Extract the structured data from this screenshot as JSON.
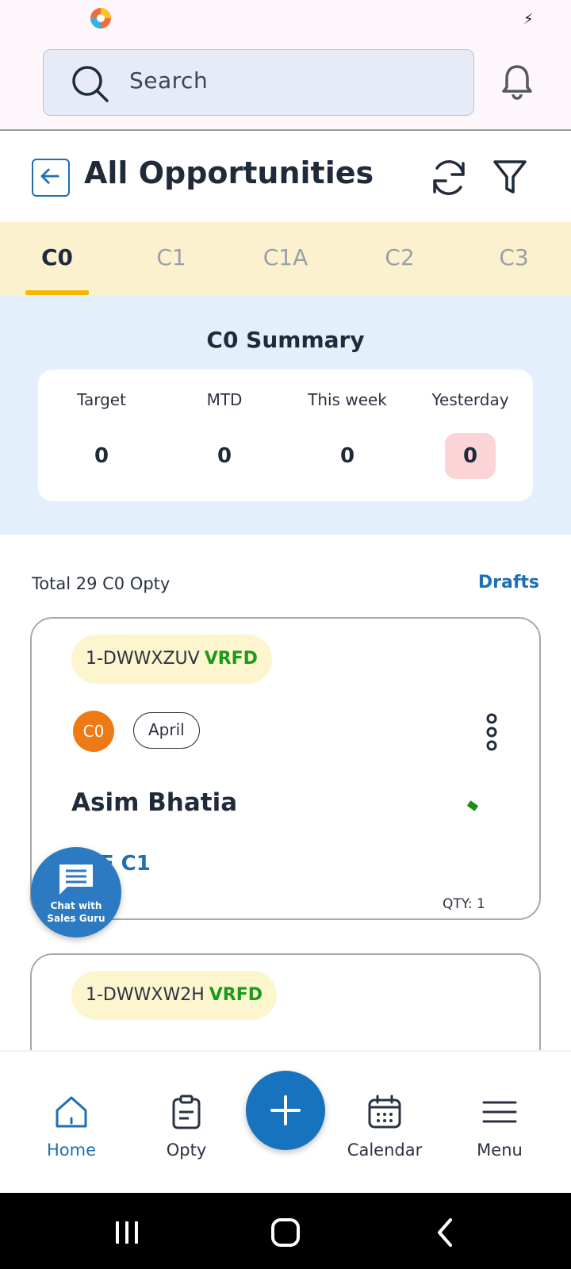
{
  "search": {
    "placeholder": "Search"
  },
  "header": {
    "title": "All Opportunities"
  },
  "tabs": [
    {
      "label": "C0",
      "active": true
    },
    {
      "label": "C1",
      "active": false
    },
    {
      "label": "C1A",
      "active": false
    },
    {
      "label": "C2",
      "active": false
    },
    {
      "label": "C3",
      "active": false
    }
  ],
  "summary": {
    "title": "C0 Summary",
    "stats": [
      {
        "label": "Target",
        "value": "0"
      },
      {
        "label": "MTD",
        "value": "0"
      },
      {
        "label": "This week",
        "value": "0"
      },
      {
        "label": "Yesterday",
        "value": "0"
      }
    ]
  },
  "list": {
    "total_text": "Total 29 C0 Opty",
    "drafts_label": "Drafts"
  },
  "cards": [
    {
      "id": "1-DWWXZUV",
      "status": "VRFD",
      "stage": "C0",
      "month": "April",
      "name": "Asim Bhatia",
      "action": "ATE C1",
      "qty": "QTY: 1"
    },
    {
      "id": "1-DWWXW2H",
      "status": "VRFD"
    }
  ],
  "chat_fab": {
    "line1": "Chat with",
    "line2": "Sales Guru"
  },
  "nav": {
    "home": "Home",
    "opty": "Opty",
    "calendar": "Calendar",
    "menu": "Menu"
  },
  "colors": {
    "accent": "#1f6fb4",
    "tab_bg": "#fbf1cf",
    "summary_bg": "#e3f0fb",
    "verified": "#1a9b1a",
    "stage_badge": "#ed7a14"
  }
}
